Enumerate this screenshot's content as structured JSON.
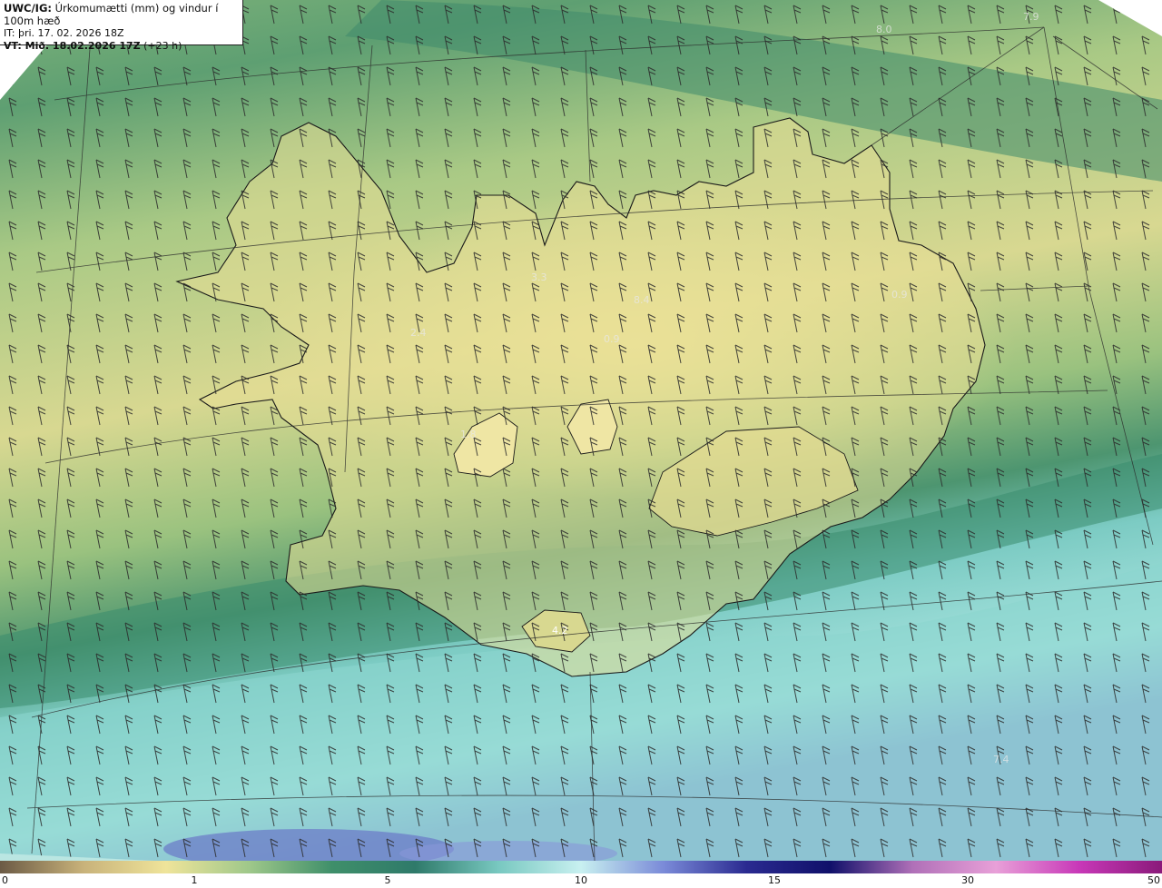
{
  "header": {
    "line1_bold": "UWC/IG:",
    "line1_text": " Úrkomumætti (mm) og vindur í 100m hæð",
    "line2": "IT: þri. 17. 02. 2026 18Z",
    "line3_bold": "VT: Mið. 18.02.2026 17Z",
    "line3_text": " (+23 h)"
  },
  "map_labels": [
    "8.0",
    "7.9",
    "3.3",
    "2.4",
    "8.4",
    "0.9",
    "0.9",
    "1.8",
    "4.2",
    "7.4"
  ],
  "colorbar": {
    "ticks": [
      "0",
      "1",
      "5",
      "10",
      "15",
      "30",
      "50"
    ],
    "colors": [
      "#6b5a45",
      "#c8b27a",
      "#efe49a",
      "#9fc88a",
      "#3f8f6a",
      "#2f7a6a",
      "#78c8c0",
      "#c8f0f0",
      "#7a8ad8",
      "#2a2a90",
      "#10106a",
      "#b070b8",
      "#e8a0d8",
      "#c838b8",
      "#8a1a7a"
    ]
  },
  "colors": {
    "background_green": "#8fba7c",
    "band_dark": "#3d8a6e",
    "land_yellow": "#e6de92",
    "sea_cyan": "#8fd8d2",
    "coast": "#1a1a1a"
  }
}
